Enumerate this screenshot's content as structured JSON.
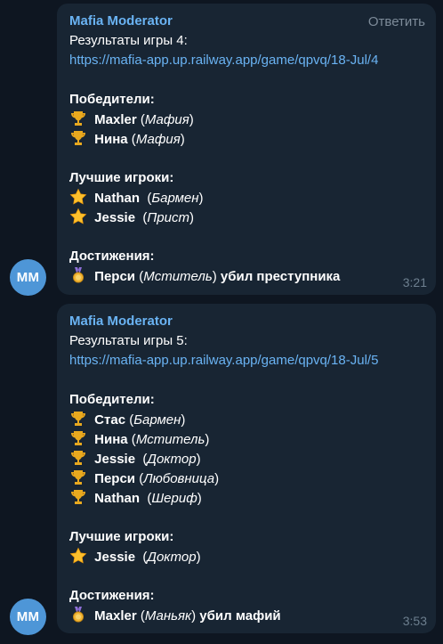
{
  "messages": [
    {
      "avatar": "MM",
      "sender": "Mafia Moderator",
      "reply_label": "Ответить",
      "title": "Результаты игры 4:",
      "link": "https://mafia-app.up.railway.app/game/qpvq/18-Jul/4",
      "winners_header": "Победители:",
      "winners": [
        {
          "name": "Maxler",
          "role": "Мафия"
        },
        {
          "name": "Нина",
          "role": "Мафия"
        }
      ],
      "best_header": "Лучшие игроки:",
      "best": [
        {
          "name": "Nathan",
          "role": "Бармен"
        },
        {
          "name": "Jessie",
          "role": "Прист"
        }
      ],
      "ach_header": "Достижения:",
      "achievements": [
        {
          "name": "Перси",
          "role": "Мститель",
          "text": "убил преступника"
        }
      ],
      "time": "3:21"
    },
    {
      "avatar": "MM",
      "sender": "Mafia Moderator",
      "title": "Результаты игры 5:",
      "link": "https://mafia-app.up.railway.app/game/qpvq/18-Jul/5",
      "winners_header": "Победители:",
      "winners": [
        {
          "name": "Стас",
          "role": "Бармен"
        },
        {
          "name": "Нина",
          "role": "Мститель"
        },
        {
          "name": "Jessie",
          "role": "Доктор"
        },
        {
          "name": "Перси",
          "role": "Любовница"
        },
        {
          "name": "Nathan",
          "role": "Шериф"
        }
      ],
      "best_header": "Лучшие игроки:",
      "best": [
        {
          "name": "Jessie",
          "role": "Доктор"
        }
      ],
      "ach_header": "Достижения:",
      "achievements": [
        {
          "name": "Maxler",
          "role": "Маньяк",
          "text": "убил мафий"
        }
      ],
      "time": "3:53"
    }
  ],
  "icons": {
    "trophy": "trophy-icon",
    "star": "star-icon",
    "medal": "medal-icon"
  },
  "colors": {
    "background": "#0e1621",
    "bubble": "#182533",
    "accent": "#6ab3f3",
    "avatar": "#4e96d7",
    "muted": "#6d7f8f"
  }
}
